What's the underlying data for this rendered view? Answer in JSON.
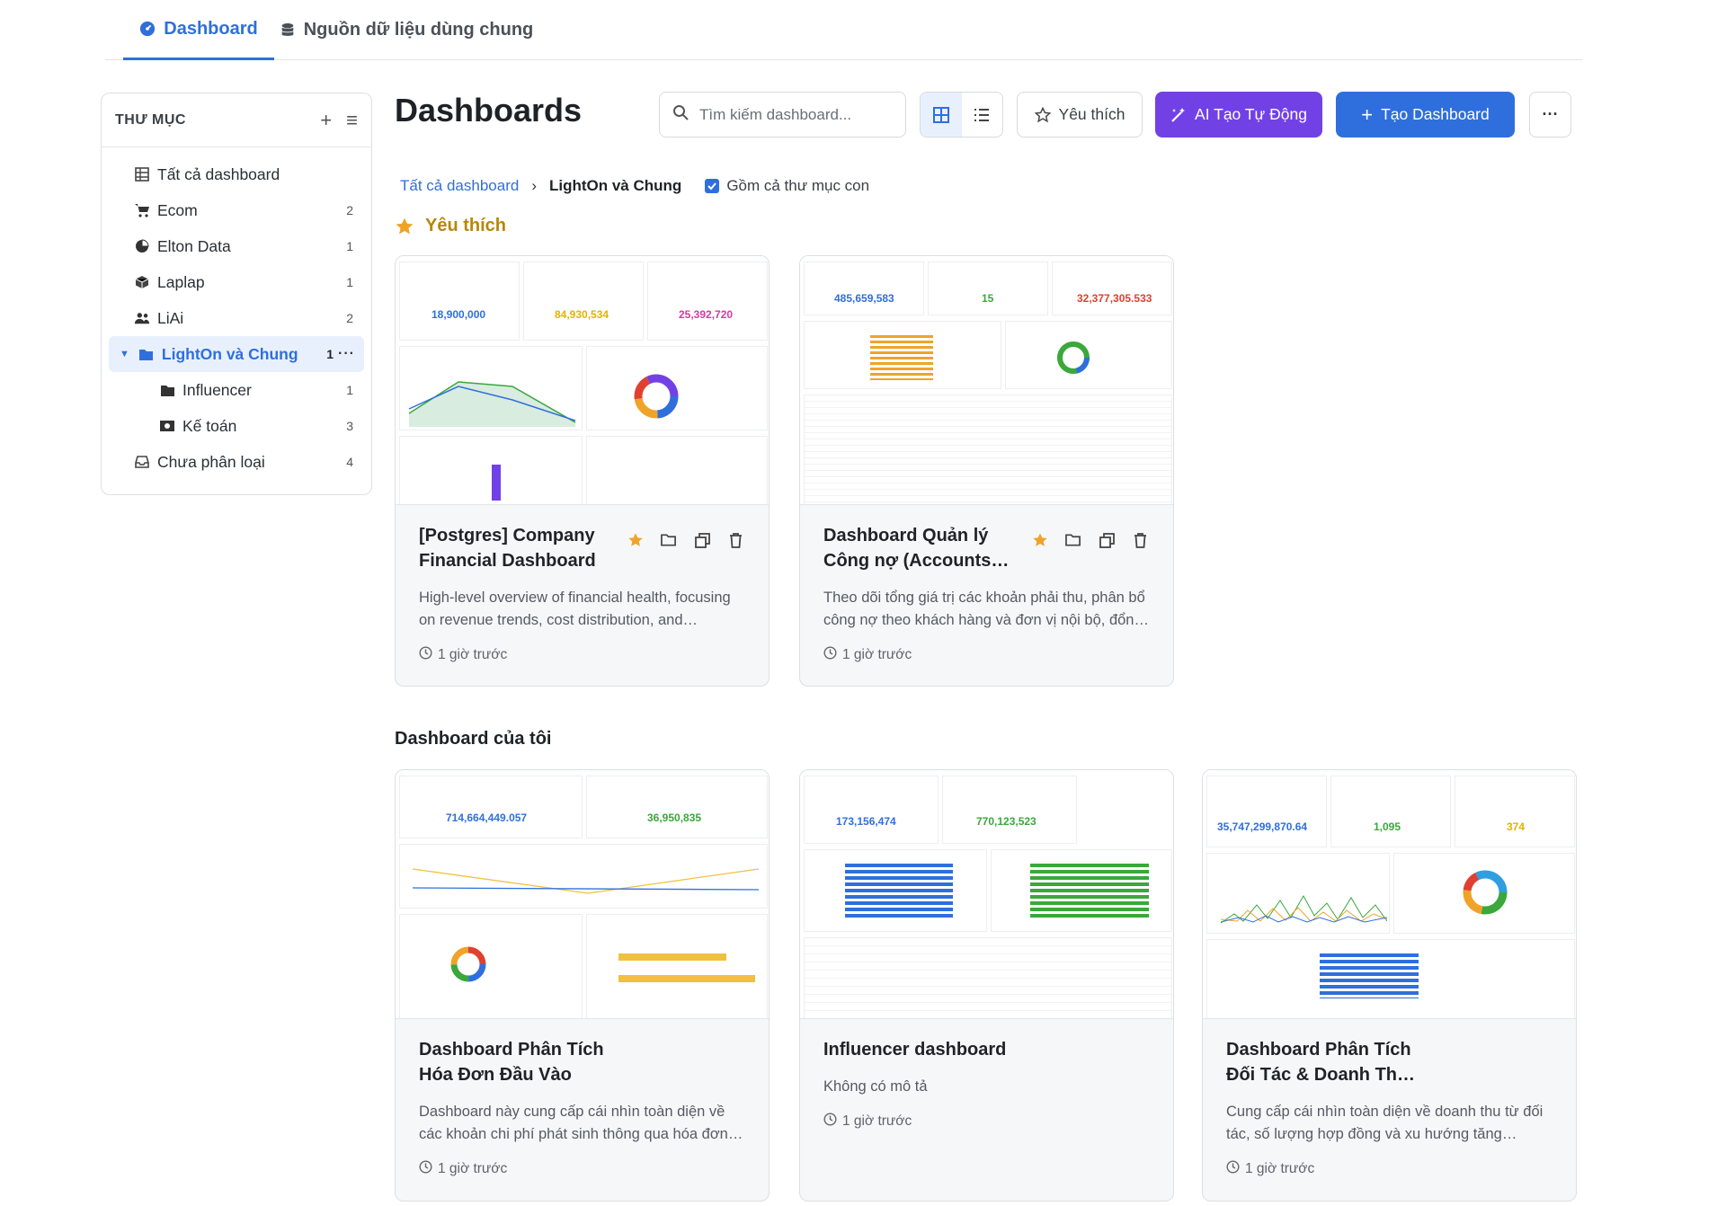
{
  "topnav": {
    "tabs": [
      {
        "label": "Dashboard"
      },
      {
        "label": "Nguồn dữ liệu dùng chung"
      }
    ]
  },
  "sidebar": {
    "title": "THƯ MỤC",
    "items": [
      {
        "label": "Tất cả dashboard",
        "count": ""
      },
      {
        "label": "Ecom",
        "count": "2"
      },
      {
        "label": "Elton Data",
        "count": "1"
      },
      {
        "label": "Laplap",
        "count": "1"
      },
      {
        "label": "LiAi",
        "count": "2"
      },
      {
        "label": "LightOn và Chung",
        "count": "1"
      },
      {
        "label": "Influencer",
        "count": "1"
      },
      {
        "label": "Kế toán",
        "count": "3"
      },
      {
        "label": "Chưa phân loại",
        "count": "4"
      }
    ]
  },
  "header": {
    "title": "Dashboards",
    "search_placeholder": "Tìm kiếm dashboard...",
    "fav_label": "Yêu thích",
    "ai_label": "AI Tạo Tự Động",
    "new_label": "Tạo Dashboard"
  },
  "breadcrumb": {
    "root": "Tất cả dashboard",
    "current": "LightOn và Chung",
    "include_sub": "Gồm cả thư mục con"
  },
  "sections": {
    "favorites": "Yêu thích",
    "mine": "Dashboard của tôi"
  },
  "favorites": [
    {
      "title": "[Postgres] Company Financial Dashboard",
      "desc": "High-level overview of financial health, focusing on revenue trends, cost distribution, and…",
      "time": "1 giờ trước",
      "kpis": [
        "18,900,000",
        "84,930,534",
        "25,392,720"
      ]
    },
    {
      "title": "Dashboard Quản lý Công nợ (Accounts…",
      "desc": "Theo dõi tổng giá trị các khoản phải thu, phân bổ công nợ theo khách hàng và đơn vị nội bộ, đổn…",
      "time": "1 giờ trước",
      "kpis": [
        "485,659,583",
        "15",
        "32,377,305.533"
      ]
    }
  ],
  "mine": [
    {
      "title": "Dashboard Phân Tích Hóa Đơn Đầu Vào",
      "desc": "Dashboard này cung cấp cái nhìn toàn diện về các khoản chi phí phát sinh thông qua hóa đơn…",
      "time": "1 giờ trước",
      "kpis": [
        "714,664,449.057",
        "36,950,835"
      ]
    },
    {
      "title": "Influencer dashboard",
      "desc": "Không có mô tả",
      "time": "1 giờ trước",
      "kpis": [
        "173,156,474",
        "770,123,523"
      ]
    },
    {
      "title": "Dashboard Phân Tích Đối Tác & Doanh Th…",
      "desc": "Cung cấp cái nhìn toàn diện về doanh thu từ đối tác, số lượng hợp đồng và xu hướng tăng…",
      "time": "1 giờ trước",
      "kpis": [
        "35,747,299,870.64",
        "1,095",
        "374"
      ]
    }
  ],
  "colors": {
    "accent": "#2f6fdd",
    "ai": "#7241e6",
    "star": "#f0a329",
    "kpi_blue": "#2f6fdd",
    "kpi_yellow": "#e0b400",
    "kpi_pink": "#d63aa0",
    "kpi_green": "#3aa83a",
    "kpi_red": "#e0402f"
  }
}
